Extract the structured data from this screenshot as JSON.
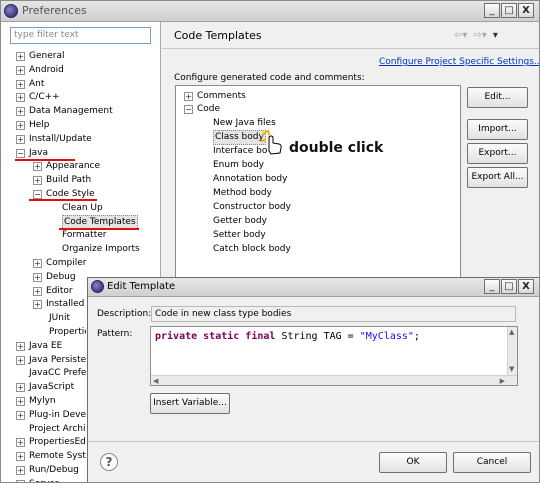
{
  "window": {
    "title": "Preferences",
    "controls": [
      "_",
      "□",
      "X"
    ]
  },
  "sidebar": {
    "filter_placeholder": "type filter text",
    "items": [
      {
        "label": "General",
        "exp": "+"
      },
      {
        "label": "Android",
        "exp": "+"
      },
      {
        "label": "Ant",
        "exp": "+"
      },
      {
        "label": "C/C++",
        "exp": "+"
      },
      {
        "label": "Data Management",
        "exp": "+"
      },
      {
        "label": "Help",
        "exp": "+"
      },
      {
        "label": "Install/Update",
        "exp": "+"
      },
      {
        "label": "Java",
        "exp": "−"
      },
      {
        "label": "Appearance",
        "exp": "+"
      },
      {
        "label": "Build Path",
        "exp": "+"
      },
      {
        "label": "Code Style",
        "exp": "−"
      },
      {
        "label": "Clean Up",
        "exp": ""
      },
      {
        "label": "Code Templates",
        "exp": ""
      },
      {
        "label": "Formatter",
        "exp": ""
      },
      {
        "label": "Organize Imports",
        "exp": ""
      },
      {
        "label": "Compiler",
        "exp": "+"
      },
      {
        "label": "Debug",
        "exp": "+"
      },
      {
        "label": "Editor",
        "exp": "+"
      },
      {
        "label": "Installed",
        "exp": "+"
      },
      {
        "label": "JUnit",
        "exp": ""
      },
      {
        "label": "Propertie",
        "exp": ""
      },
      {
        "label": "Java EE",
        "exp": "+"
      },
      {
        "label": "Java Persiste",
        "exp": "+"
      },
      {
        "label": "JavaCC Prefe",
        "exp": ""
      },
      {
        "label": "JavaScript",
        "exp": "+"
      },
      {
        "label": "Mylyn",
        "exp": "+"
      },
      {
        "label": "Plug-in Develo",
        "exp": "+"
      },
      {
        "label": "Project Archiv",
        "exp": ""
      },
      {
        "label": "PropertiesEdi",
        "exp": "+"
      },
      {
        "label": "Remote Syste",
        "exp": "+"
      },
      {
        "label": "Run/Debug",
        "exp": "+"
      },
      {
        "label": "Server",
        "exp": "+"
      }
    ]
  },
  "main": {
    "title": "Code Templates",
    "nav_icons": [
      "back-arrow-icon",
      "forward-arrow-icon",
      "menu-dropdown-icon"
    ],
    "link": "Configure Project Specific Settings...",
    "description": "Configure generated code and comments:",
    "tree": [
      {
        "label": "Comments",
        "exp": "+"
      },
      {
        "label": "Code",
        "exp": "−"
      },
      {
        "label": "New Java files",
        "exp": ""
      },
      {
        "label": "Class body",
        "exp": ""
      },
      {
        "label": "Interface bo",
        "exp": ""
      },
      {
        "label": "Enum body",
        "exp": ""
      },
      {
        "label": "Annotation body",
        "exp": ""
      },
      {
        "label": "Method body",
        "exp": ""
      },
      {
        "label": "Constructor body",
        "exp": ""
      },
      {
        "label": "Getter body",
        "exp": ""
      },
      {
        "label": "Setter body",
        "exp": ""
      },
      {
        "label": "Catch block body",
        "exp": ""
      }
    ],
    "buttons": {
      "edit": "Edit...",
      "import": "Import...",
      "export": "Export...",
      "export_all": "Export All..."
    },
    "annotation": "double click"
  },
  "dialog": {
    "title": "Edit Template",
    "controls": [
      "_",
      "□",
      "X"
    ],
    "description_label": "Description:",
    "description_value": "Code in new class type bodies",
    "pattern_label": "Pattern:",
    "pattern": {
      "kw": "private static final",
      "mid": " String TAG = ",
      "str": "\"MyClass\"",
      "end": ";"
    },
    "insert_variable": "Insert Variable...",
    "ok": "OK",
    "cancel": "Cancel",
    "help": "?"
  },
  "colors": {
    "keyword": "#7f0055",
    "string": "#2a00ff",
    "annotation_underline": "#e01010",
    "link": "#0033cc"
  }
}
